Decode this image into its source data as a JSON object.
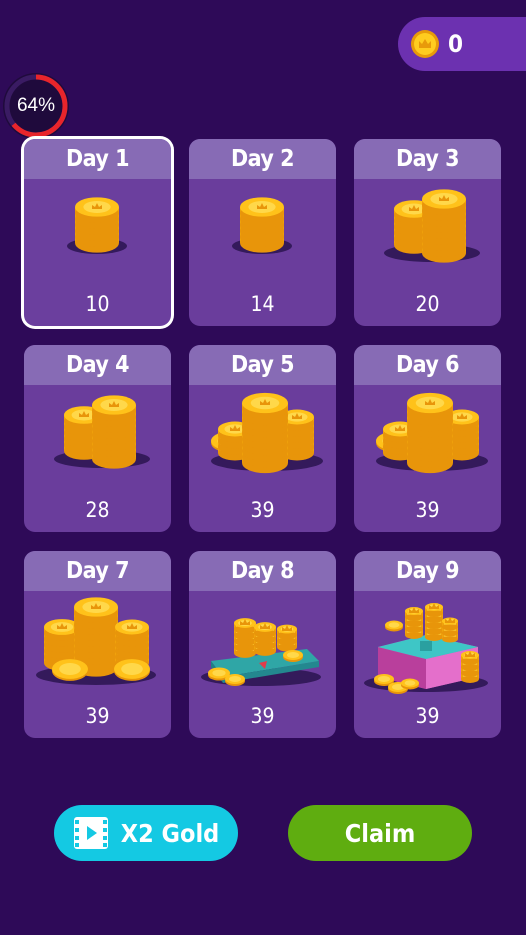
{
  "currency": {
    "coins": "0",
    "icon": "crown-coin-icon"
  },
  "progress": {
    "label": "64%",
    "value": 0.64
  },
  "days": [
    {
      "label": "Day 1",
      "amount": "10",
      "art": "coin-stack-small",
      "selected": true
    },
    {
      "label": "Day 2",
      "amount": "14",
      "art": "coin-stack-small",
      "selected": false
    },
    {
      "label": "Day 3",
      "amount": "20",
      "art": "coin-stacks-two",
      "selected": false
    },
    {
      "label": "Day 4",
      "amount": "28",
      "art": "coin-stacks-two",
      "selected": false
    },
    {
      "label": "Day 5",
      "amount": "39",
      "art": "coin-stacks-three",
      "selected": false
    },
    {
      "label": "Day 6",
      "amount": "39",
      "art": "coin-stacks-three",
      "selected": false
    },
    {
      "label": "Day 7",
      "amount": "39",
      "art": "coin-stacks-many",
      "selected": false
    },
    {
      "label": "Day 8",
      "amount": "39",
      "art": "coin-tray",
      "selected": false
    },
    {
      "label": "Day 9",
      "amount": "39",
      "art": "treasure-chest",
      "selected": false
    }
  ],
  "buttons": {
    "x2_gold": {
      "label": "X2 Gold",
      "icon": "video-film-icon"
    },
    "claim": {
      "label": "Claim"
    }
  },
  "colors": {
    "background": "#2e0a58",
    "card": "#6a3d9c",
    "card_header": "#876bb5",
    "x2_button": "#14c9e3",
    "claim_button": "#5fad10",
    "progress_ring": "#e8252b",
    "coin_gold": "#ffc21a"
  }
}
